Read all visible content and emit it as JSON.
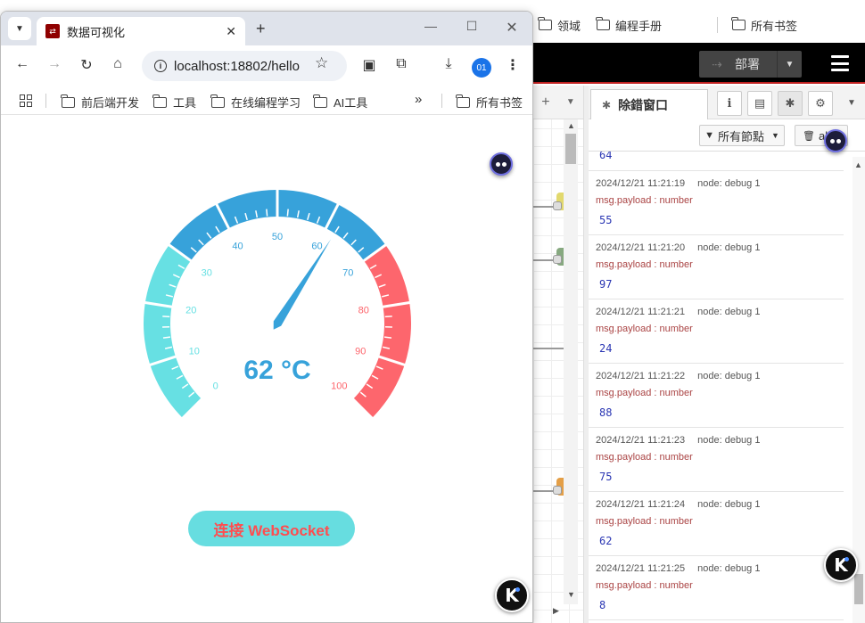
{
  "background": {
    "bookmarks": [
      "领域",
      "编程手册",
      "所有书签"
    ],
    "nodered": {
      "deploy_label": "部署",
      "sidebar_tab_title": "除錯窗口",
      "filter_label": "所有節點",
      "clear_label": "all"
    },
    "messages": [
      {
        "time": "2024/12/21 11:21:19",
        "node": "node: debug 1",
        "topic": "msg.payload : number",
        "value": "55"
      },
      {
        "time": "2024/12/21 11:21:20",
        "node": "node: debug 1",
        "topic": "msg.payload : number",
        "value": "97"
      },
      {
        "time": "2024/12/21 11:21:21",
        "node": "node: debug 1",
        "topic": "msg.payload : number",
        "value": "24"
      },
      {
        "time": "2024/12/21 11:21:22",
        "node": "node: debug 1",
        "topic": "msg.payload : number",
        "value": "88"
      },
      {
        "time": "2024/12/21 11:21:23",
        "node": "node: debug 1",
        "topic": "msg.payload : number",
        "value": "75"
      },
      {
        "time": "2024/12/21 11:21:24",
        "node": "node: debug 1",
        "topic": "msg.payload : number",
        "value": "62"
      },
      {
        "time": "2024/12/21 11:21:25",
        "node": "node: debug 1",
        "topic": "msg.payload : number",
        "value": "8"
      }
    ],
    "partial_value": "64"
  },
  "browser": {
    "tab_title": "数据可视化",
    "url": "localhost:18802/hello",
    "profile_label": "01",
    "bookmarks": [
      "前后端开发",
      "工具",
      "在线编程学习",
      "AI工具",
      "所有书签"
    ]
  },
  "gauge": {
    "value": 62,
    "unit": "°C",
    "display": "62 °C",
    "min": 0,
    "max": 100,
    "tick_labels": [
      "0",
      "10",
      "20",
      "30",
      "40",
      "50",
      "60",
      "70",
      "80",
      "90",
      "100"
    ],
    "bands": [
      {
        "to": 30,
        "color": "#67e0e3"
      },
      {
        "to": 70,
        "color": "#37a2da"
      },
      {
        "to": 100,
        "color": "#fd666d"
      }
    ]
  },
  "button": {
    "label": "连接 WebSocket"
  }
}
